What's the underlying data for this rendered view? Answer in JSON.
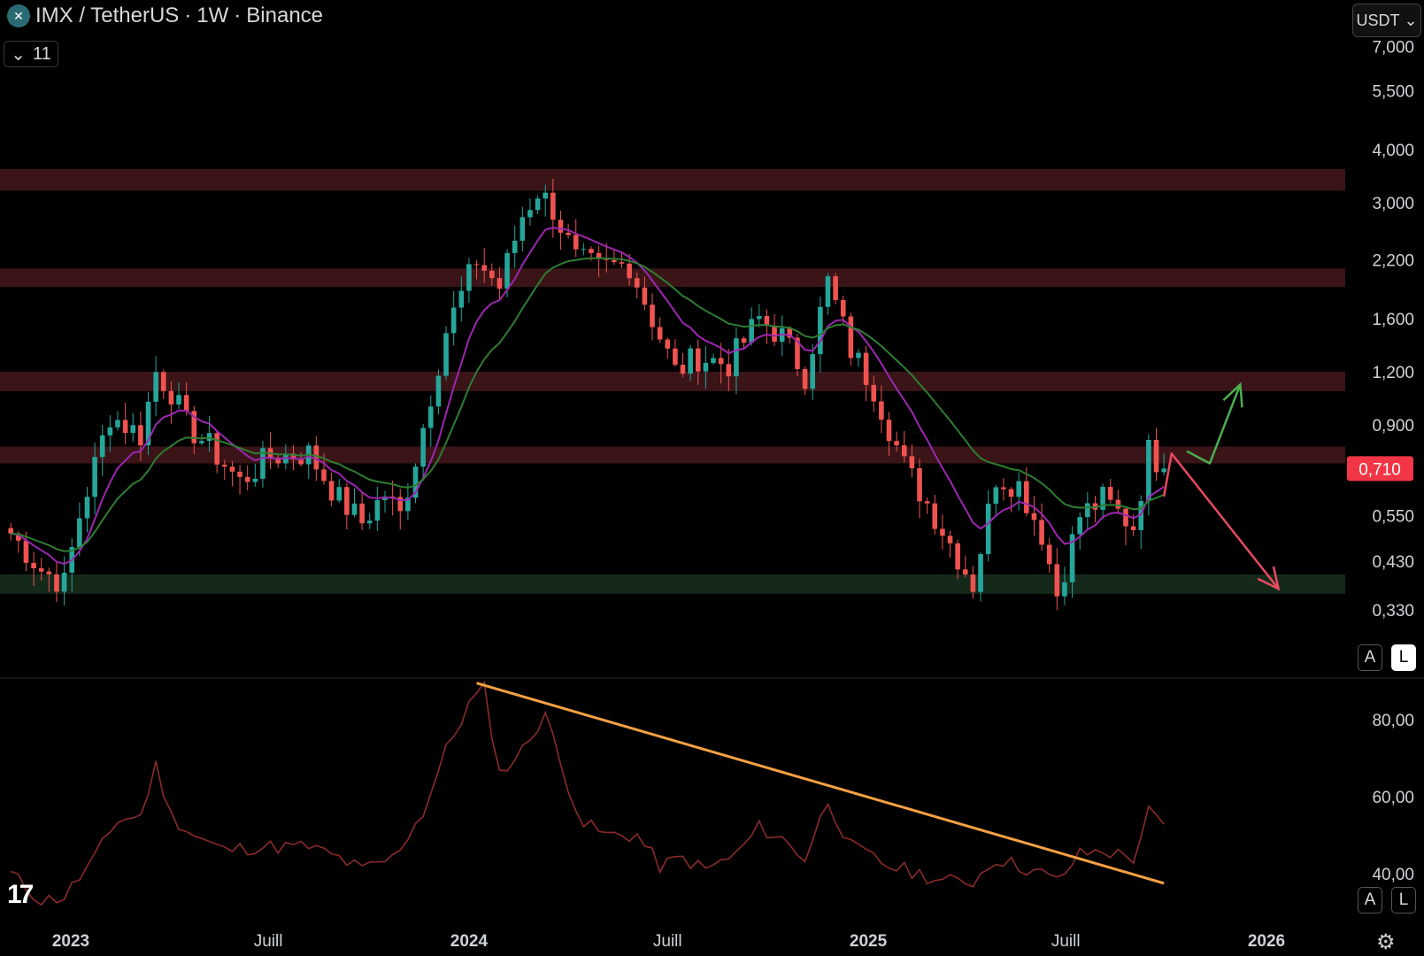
{
  "header": {
    "symbol": "IMX / TetherUS",
    "interval": "1W",
    "exchange": "Binance",
    "indicator_count": "11",
    "currency": "USDT"
  },
  "price_scale_buttons": {
    "auto": "A",
    "log": "L"
  },
  "rsi_scale_buttons": {
    "auto": "A",
    "log": "L"
  },
  "colors": {
    "up": "#26a69a",
    "down": "#ef5350",
    "zone_resistance": "#3a1417",
    "zone_support": "#15291a",
    "ema_fast": "#9c27b0",
    "ema_slow": "#2e7d32",
    "rsi": "#8b2a2a",
    "trendline": "#f5a142",
    "arrow_bull": "#4caf50",
    "arrow_bear": "#e84a5f",
    "last_price_bg": "#f23645"
  },
  "chart_data": [
    {
      "type": "candlestick",
      "scale": "log",
      "title": "IMX / TetherUS · 1W · Binance",
      "ylim": [
        0.28,
        7.8
      ],
      "y_ticks": [
        "7,000",
        "5,500",
        "4,000",
        "3,000",
        "2,200",
        "1,600",
        "1,200",
        "0,900",
        "0,550",
        "0,430",
        "0,330"
      ],
      "y_tick_values": [
        7.0,
        5.5,
        4.0,
        3.0,
        2.2,
        1.6,
        1.2,
        0.9,
        0.55,
        0.43,
        0.33
      ],
      "x_ticks": [
        "2023",
        "Juill",
        "2024",
        "Juill",
        "2025",
        "Juill",
        "2026"
      ],
      "x_tick_dates": [
        "2023-01-01",
        "2023-07-01",
        "2024-01-01",
        "2024-07-01",
        "2025-01-01",
        "2025-07-01",
        "2026-01-01"
      ],
      "last_price": "0,710",
      "last_price_value": 0.71,
      "anchors": [
        [
          "2022-11-07",
          0.5
        ],
        [
          "2022-12-05",
          0.41
        ],
        [
          "2022-12-26",
          0.38
        ],
        [
          "2023-01-09",
          0.55
        ],
        [
          "2023-02-06",
          0.95
        ],
        [
          "2023-03-06",
          0.85
        ],
        [
          "2023-03-20",
          1.2
        ],
        [
          "2023-04-03",
          1.08
        ],
        [
          "2023-04-17",
          0.9
        ],
        [
          "2023-05-08",
          0.8
        ],
        [
          "2023-06-05",
          0.66
        ],
        [
          "2023-07-03",
          0.76
        ],
        [
          "2023-08-07",
          0.77
        ],
        [
          "2023-09-04",
          0.6
        ],
        [
          "2023-09-25",
          0.53
        ],
        [
          "2023-10-16",
          0.62
        ],
        [
          "2023-10-30",
          0.55
        ],
        [
          "2023-11-13",
          0.75
        ],
        [
          "2023-12-11",
          1.5
        ],
        [
          "2024-01-08",
          2.2
        ],
        [
          "2024-01-29",
          1.9
        ],
        [
          "2024-02-19",
          2.8
        ],
        [
          "2024-03-04",
          3.2
        ],
        [
          "2024-03-18",
          2.9
        ],
        [
          "2024-04-08",
          2.2
        ],
        [
          "2024-04-29",
          2.1
        ],
        [
          "2024-05-27",
          2.15
        ],
        [
          "2024-06-17",
          1.6
        ],
        [
          "2024-07-08",
          1.2
        ],
        [
          "2024-07-29",
          1.3
        ],
        [
          "2024-08-26",
          1.25
        ],
        [
          "2024-09-23",
          1.6
        ],
        [
          "2024-10-14",
          1.45
        ],
        [
          "2024-11-04",
          1.18
        ],
        [
          "2024-11-25",
          1.95
        ],
        [
          "2024-12-16",
          1.35
        ],
        [
          "2025-01-06",
          1.1
        ],
        [
          "2025-02-03",
          0.72
        ],
        [
          "2025-03-03",
          0.55
        ],
        [
          "2025-04-07",
          0.38
        ],
        [
          "2025-04-28",
          0.68
        ],
        [
          "2025-05-19",
          0.65
        ],
        [
          "2025-06-09",
          0.5
        ],
        [
          "2025-06-23",
          0.36
        ],
        [
          "2025-07-14",
          0.55
        ],
        [
          "2025-08-04",
          0.6
        ],
        [
          "2025-09-01",
          0.52
        ],
        [
          "2025-09-15",
          0.78
        ],
        [
          "2025-09-29",
          0.71
        ]
      ],
      "zones": [
        {
          "kind": "resistance",
          "from": 3.2,
          "to": 3.6
        },
        {
          "kind": "resistance",
          "from": 1.9,
          "to": 2.1
        },
        {
          "kind": "resistance",
          "from": 1.08,
          "to": 1.2
        },
        {
          "kind": "resistance",
          "from": 0.73,
          "to": 0.8
        },
        {
          "kind": "support",
          "from": 0.36,
          "to": 0.4
        }
      ],
      "scenario_bullish": [
        [
          "2025-10-20",
          0.78
        ],
        [
          "2025-11-10",
          0.73
        ],
        [
          "2025-12-08",
          1.12
        ]
      ],
      "scenario_bearish": [
        [
          "2025-09-29",
          0.61
        ],
        [
          "2025-10-06",
          0.77
        ],
        [
          "2026-01-12",
          0.37
        ]
      ]
    },
    {
      "type": "line",
      "series": [
        {
          "name": "",
          "kind": "rsi"
        }
      ],
      "ylim": [
        36,
        90
      ],
      "y_ticks": [
        "80,00",
        "60,00",
        "40,00"
      ],
      "y_tick_values": [
        80,
        60,
        40
      ],
      "points": [
        [
          "2022-11-07",
          40
        ],
        [
          "2022-12-05",
          33
        ],
        [
          "2022-12-26",
          34
        ],
        [
          "2023-01-23",
          44
        ],
        [
          "2023-02-13",
          54
        ],
        [
          "2023-03-06",
          55
        ],
        [
          "2023-03-20",
          68
        ],
        [
          "2023-04-03",
          55
        ],
        [
          "2023-04-24",
          50
        ],
        [
          "2023-05-22",
          46
        ],
        [
          "2023-06-19",
          47
        ],
        [
          "2023-07-10",
          47
        ],
        [
          "2023-08-07",
          47
        ],
        [
          "2023-09-04",
          44
        ],
        [
          "2023-09-25",
          41
        ],
        [
          "2023-10-23",
          44
        ],
        [
          "2023-11-20",
          56
        ],
        [
          "2023-12-11",
          72
        ],
        [
          "2024-01-01",
          84
        ],
        [
          "2024-01-15",
          88
        ],
        [
          "2024-01-29",
          66
        ],
        [
          "2024-02-19",
          72
        ],
        [
          "2024-03-11",
          82
        ],
        [
          "2024-03-25",
          68
        ],
        [
          "2024-04-15",
          53
        ],
        [
          "2024-05-06",
          50
        ],
        [
          "2024-06-03",
          50
        ],
        [
          "2024-06-24",
          42
        ],
        [
          "2024-07-15",
          44
        ],
        [
          "2024-08-05",
          41
        ],
        [
          "2024-09-02",
          45
        ],
        [
          "2024-09-23",
          52
        ],
        [
          "2024-10-14",
          49
        ],
        [
          "2024-11-04",
          44
        ],
        [
          "2024-11-25",
          59
        ],
        [
          "2024-12-16",
          47
        ],
        [
          "2025-01-20",
          42
        ],
        [
          "2025-02-17",
          40
        ],
        [
          "2025-03-10",
          38
        ],
        [
          "2025-04-07",
          38
        ],
        [
          "2025-04-28",
          44
        ],
        [
          "2025-05-19",
          42
        ],
        [
          "2025-06-09",
          40
        ],
        [
          "2025-06-23",
          38
        ],
        [
          "2025-07-14",
          45
        ],
        [
          "2025-08-04",
          46
        ],
        [
          "2025-09-01",
          44
        ],
        [
          "2025-09-15",
          56
        ],
        [
          "2025-09-29",
          52
        ]
      ],
      "trendline": [
        [
          "2024-01-08",
          89.5
        ],
        [
          "2025-09-29",
          37.5
        ]
      ]
    }
  ]
}
